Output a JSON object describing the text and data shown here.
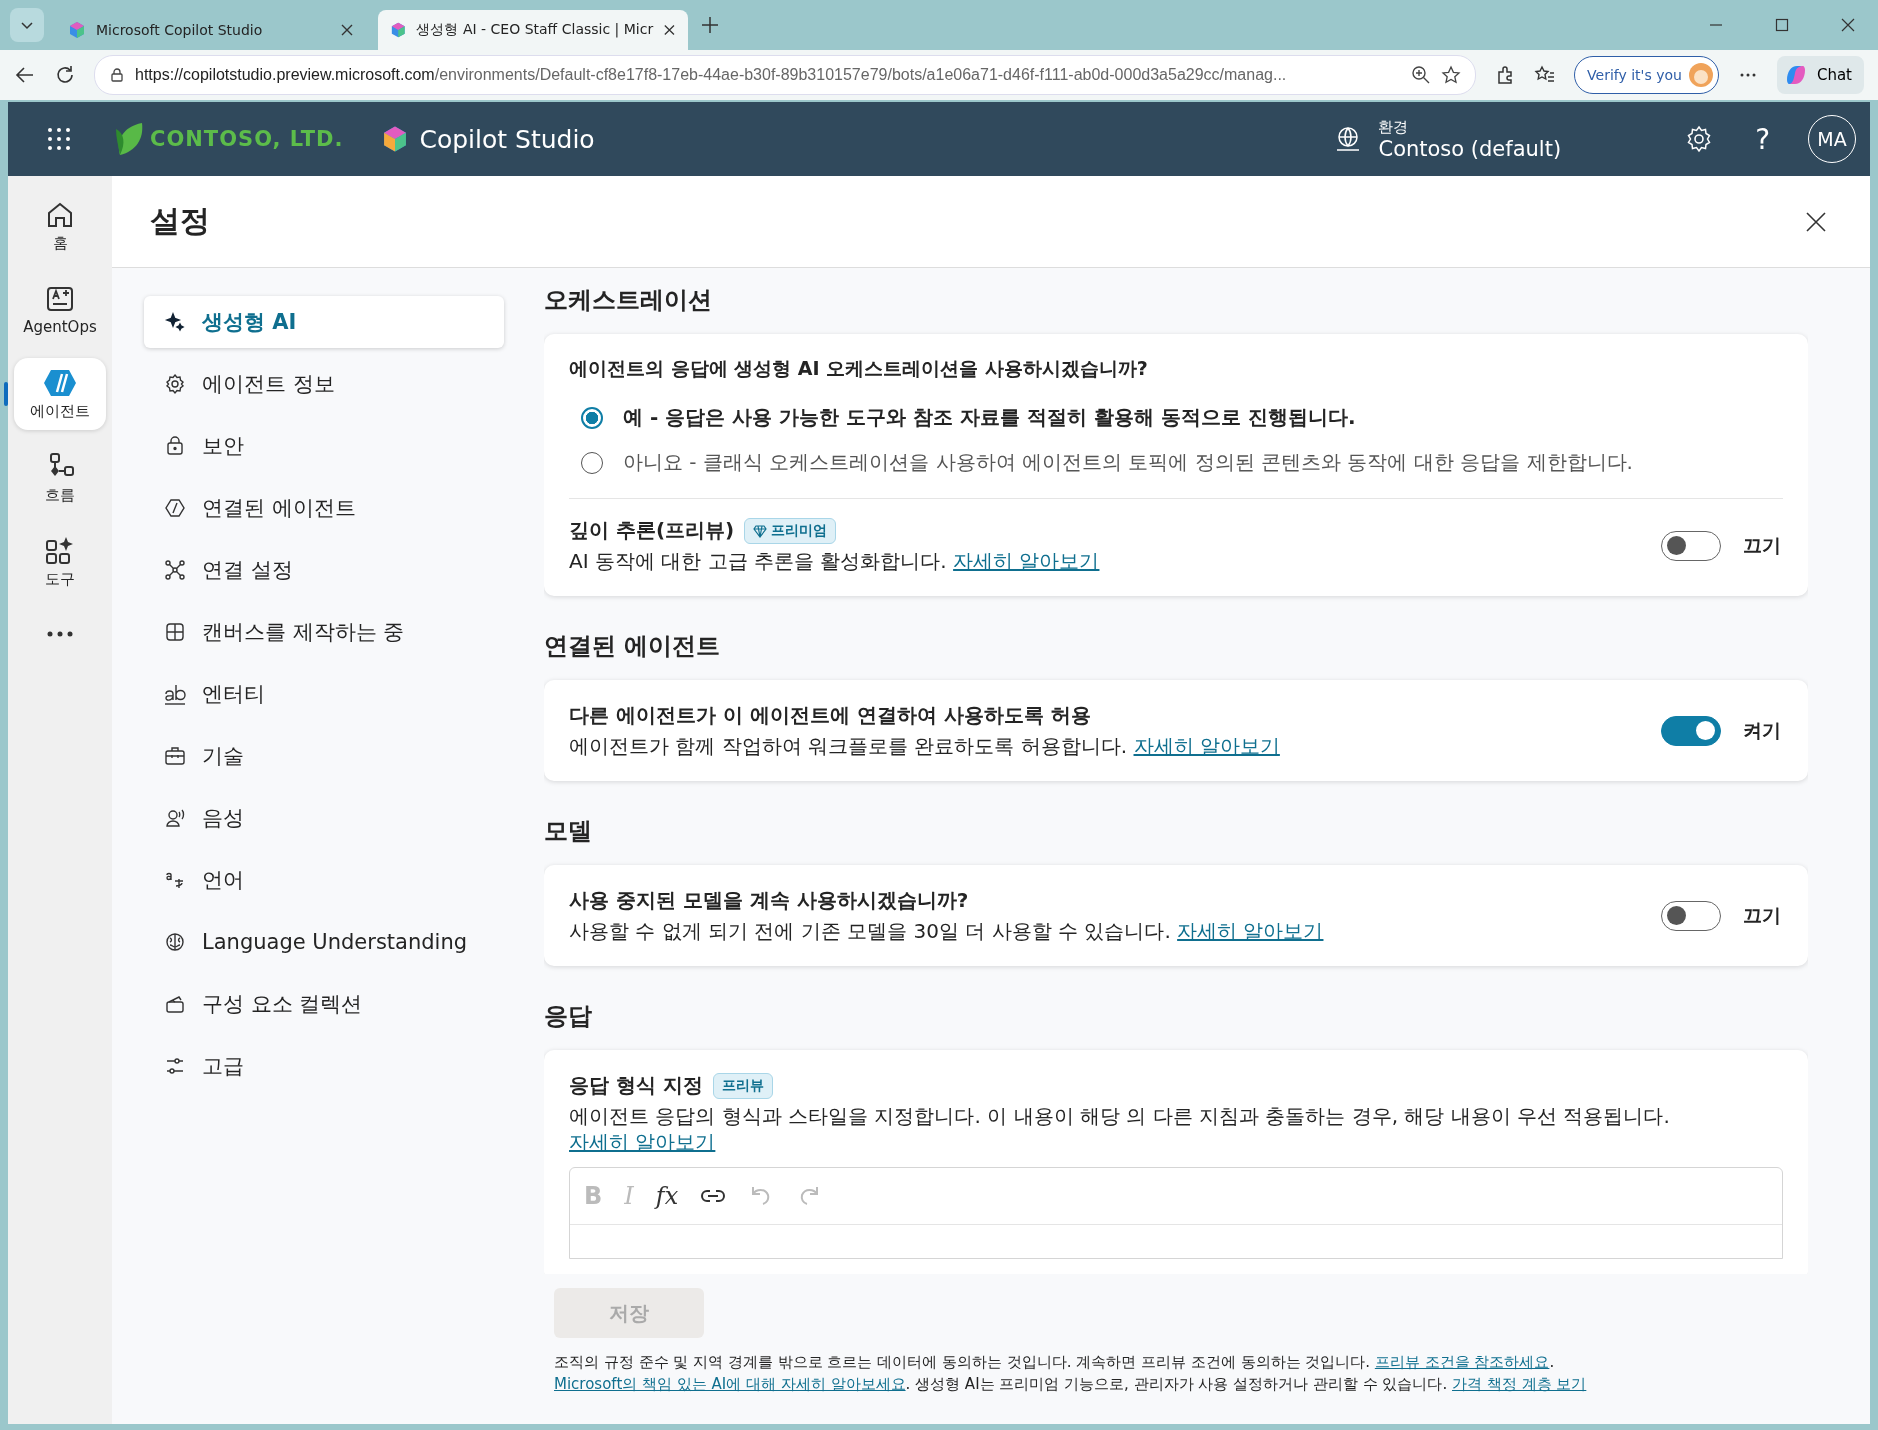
{
  "browser": {
    "tabs": [
      {
        "title": "Microsoft Copilot Studio",
        "selected": false
      },
      {
        "title": "생성형 AI - CEO Staff Classic | Micr",
        "selected": true
      }
    ],
    "url": {
      "host": "https://copilotstudio.preview.microsoft.com",
      "path": "/environments/Default-cf8e17f8-17eb-44ae-b30f-89b310157e79/bots/a1e06a71-d46f-f111-ab0d-000d3a5a29cc/manag..."
    },
    "verify_button": "Verify it's you",
    "chat_button": "Chat"
  },
  "header": {
    "org": "CONTOSO, LTD.",
    "product": "Copilot Studio",
    "environment_label": "환경",
    "environment": "Contoso (default)",
    "help": "?",
    "avatar": "MA"
  },
  "rail": [
    {
      "label": "홈",
      "selected": false
    },
    {
      "label": "AgentOps",
      "selected": false
    },
    {
      "label": "에이전트",
      "selected": true
    },
    {
      "label": "흐름",
      "selected": false
    },
    {
      "label": "도구",
      "selected": false
    }
  ],
  "settings": {
    "title": "설정",
    "nav": [
      {
        "label": "생성형 AI",
        "selected": true
      },
      {
        "label": "에이전트 정보",
        "selected": false
      },
      {
        "label": "보안",
        "selected": false
      },
      {
        "label": "연결된 에이전트",
        "selected": false
      },
      {
        "label": "연결 설정",
        "selected": false
      },
      {
        "label": "캔버스를 제작하는 중",
        "selected": false
      },
      {
        "label": "엔터티",
        "selected": false
      },
      {
        "label": "기술",
        "selected": false
      },
      {
        "label": "음성",
        "selected": false
      },
      {
        "label": "언어",
        "selected": false
      },
      {
        "label": "Language Understanding",
        "selected": false
      },
      {
        "label": "구성 요소 컬렉션",
        "selected": false
      },
      {
        "label": "고급",
        "selected": false
      }
    ],
    "sections": [
      {
        "heading": "오케스트레이션",
        "kind": "orchestration",
        "question": "에이전트의 응답에 생성형 AI 오케스트레이션을 사용하시겠습니까?",
        "options": [
          {
            "label": "예 - 응답은 사용 가능한 도구와 참조 자료를 적절히 활용해 동적으로 진행됩니다.",
            "selected": true
          },
          {
            "label": "아니요 - 클래식 오케스트레이션을 사용하여 에이전트의 토픽에 정의된 콘텐츠와 동작에 대한 응답을 제한합니다.",
            "selected": false
          }
        ],
        "setting": {
          "title": "깊이 추론(프리뷰)",
          "badge": "프리미엄",
          "description": "AI 동작에 대한 고급 추론을 활성화합니다.",
          "link": "자세히 알아보기",
          "on": false,
          "state_label": "끄기"
        }
      },
      {
        "heading": "연결된 에이전트",
        "kind": "toggle",
        "setting": {
          "title": "다른 에이전트가 이 에이전트에 연결하여 사용하도록 허용",
          "description": "에이전트가 함께 작업하여 워크플로를 완료하도록 허용합니다.",
          "link": "자세히 알아보기",
          "on": true,
          "state_label": "켜기"
        }
      },
      {
        "heading": "모델",
        "kind": "toggle",
        "setting": {
          "title": "사용 중지된 모델을 계속 사용하시겠습니까?",
          "description": "사용할 수 없게 되기 전에 기존 모델을 30일 더 사용할 수 있습니다.",
          "link": "자세히 알아보기",
          "on": false,
          "state_label": "끄기"
        }
      },
      {
        "heading": "응답",
        "kind": "editor",
        "setting": {
          "title": "응답 형식 지정",
          "badge": "프리뷰",
          "description": "에이전트 응답의 형식과 스타일을 지정합니다. 이 내용이 해당 의 다른 지침과 충돌하는 경우, 해당 내용이 우선 적용됩니다.",
          "link": "자세히 알아보기"
        },
        "toolbar": [
          {
            "kind": "bold",
            "label": "B",
            "disabled": true
          },
          {
            "kind": "italic",
            "label": "I",
            "disabled": true
          },
          {
            "kind": "formula",
            "label": "fx",
            "disabled": false
          },
          {
            "kind": "link",
            "disabled": false
          },
          {
            "kind": "undo",
            "disabled": true
          },
          {
            "kind": "redo",
            "disabled": true
          }
        ]
      }
    ],
    "save_button": {
      "label": "저장",
      "disabled": true
    },
    "notice": [
      {
        "text": "조직의 규정 준수 및 지역 경계를 밖으로 흐르는 데이터에 동의하는 것입니다. 계속하면 프리뷰 조건에 동의하는 것입니다. ",
        "link": false
      },
      {
        "text": "프리뷰 조건을 참조하세요",
        "link": true
      },
      {
        "text": ". ",
        "link": false
      },
      {
        "text": "Microsoft의 책임 있는 AI에 대해 자세히 알아보세요",
        "link": true
      },
      {
        "text": ". 생성형 AI는 프리미엄 기능으로, 관리자가 사용 설정하거나 관리할 수 있습니다. ",
        "link": false
      },
      {
        "text": "가격 책정 계층 보기",
        "link": true
      }
    ]
  }
}
